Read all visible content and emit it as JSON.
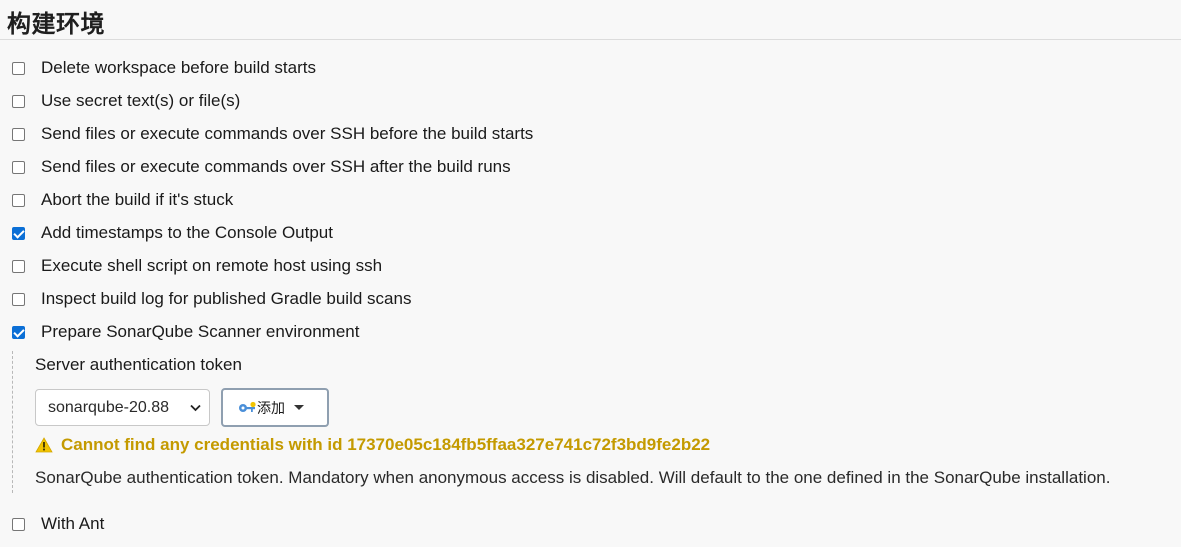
{
  "section": {
    "title": "构建环境"
  },
  "options": [
    {
      "label": "Delete workspace before build starts",
      "checked": false
    },
    {
      "label": "Use secret text(s) or file(s)",
      "checked": false
    },
    {
      "label": "Send files or execute commands over SSH before the build starts",
      "checked": false
    },
    {
      "label": "Send files or execute commands over SSH after the build runs",
      "checked": false
    },
    {
      "label": "Abort the build if it's stuck",
      "checked": false
    },
    {
      "label": "Add timestamps to the Console Output",
      "checked": true
    },
    {
      "label": "Execute shell script on remote host using ssh",
      "checked": false
    },
    {
      "label": "Inspect build log for published Gradle build scans",
      "checked": false
    },
    {
      "label": "Prepare SonarQube Scanner environment",
      "checked": true
    },
    {
      "label": "With Ant",
      "checked": false
    }
  ],
  "sonarqube": {
    "field_label": "Server authentication token",
    "selected_credential": "sonarqube-20.88",
    "add_button_label": "添加",
    "warning_text": "Cannot find any credentials with id 17370e05c184fb5ffaa327e741c72f3bd9fe2b22",
    "help_text": "SonarQube authentication token. Mandatory when anonymous access is disabled. Will default to the one defined in the SonarQube installation."
  },
  "icons": {
    "select_chevron": "chevron-down-icon",
    "add_button_icon": "key-icon",
    "add_button_caret": "caret-down-icon",
    "warning": "warning-icon"
  },
  "colors": {
    "checkbox_checked": "#0b6fd6",
    "warning_text": "#c49a00",
    "background": "#f8f8f8"
  }
}
